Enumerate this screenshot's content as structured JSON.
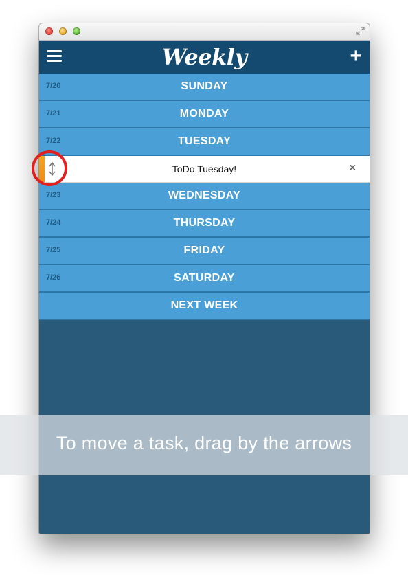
{
  "window": {
    "fullscreen_icon": "expand-icon"
  },
  "header": {
    "menu_icon": "hamburger-menu-icon",
    "title": "Weekly",
    "add_label": "+"
  },
  "days": [
    {
      "date": "7/20",
      "name": "SUNDAY"
    },
    {
      "date": "7/21",
      "name": "MONDAY"
    },
    {
      "date": "7/22",
      "name": "TUESDAY"
    },
    {
      "date": "7/23",
      "name": "WEDNESDAY"
    },
    {
      "date": "7/24",
      "name": "THURSDAY"
    },
    {
      "date": "7/25",
      "name": "FRIDAY"
    },
    {
      "date": "7/26",
      "name": "SATURDAY"
    },
    {
      "date": "",
      "name": "NEXT WEEK"
    }
  ],
  "task": {
    "text": "ToDo Tuesday!",
    "delete_label": "×",
    "drag_icon": "vertical-arrows-icon"
  },
  "overlay": {
    "message": "To move a task, drag by the arrows"
  },
  "colors": {
    "header_bg": "#154a70",
    "day_row_bg": "#4aa0d6",
    "window_bg": "#2a5a7a",
    "task_grip": "#f08b0f",
    "highlight_ring": "#e02020"
  }
}
